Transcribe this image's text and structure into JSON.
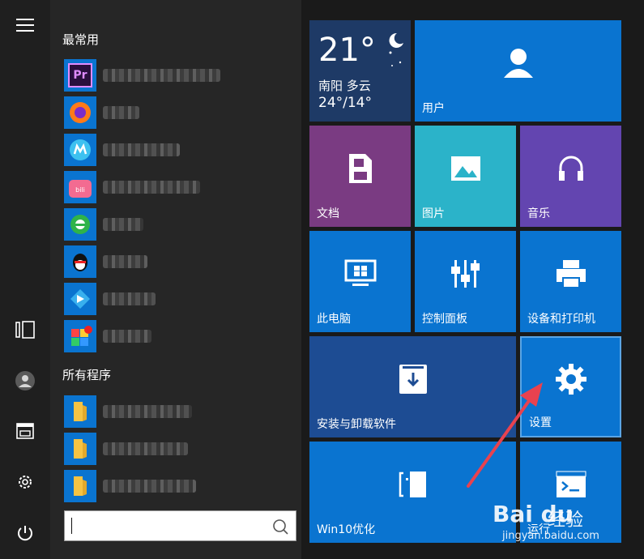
{
  "start_menu": {
    "sections": {
      "frequent": "最常用",
      "all_programs": "所有程序"
    },
    "pr_icon_text": "Pr",
    "search": {
      "value": "",
      "placeholder": ""
    }
  },
  "tiles": {
    "weather": {
      "temp": "21°",
      "city_condition": "南阳 多云",
      "range": "24°/14°"
    },
    "user": "用户",
    "documents": "文档",
    "pictures": "图片",
    "music": "音乐",
    "this_pc": "此电脑",
    "control_panel": "控制面板",
    "devices_printers": "设备和打印机",
    "install_uninstall": "安装与卸载软件",
    "settings": "设置",
    "win10": "Win10优化",
    "run": "运行"
  },
  "watermark": {
    "logo": "Bai du",
    "sub": "经验",
    "url": "jingyan.baidu.com"
  },
  "colors": {
    "tile_blue": "#0a74d0",
    "documents_purple": "#7a3b82",
    "pictures_teal": "#2bb3c9",
    "music_purple": "#6345b0",
    "install_dark_blue": "#1d4c93",
    "annotation_arrow": "#e8424f"
  }
}
